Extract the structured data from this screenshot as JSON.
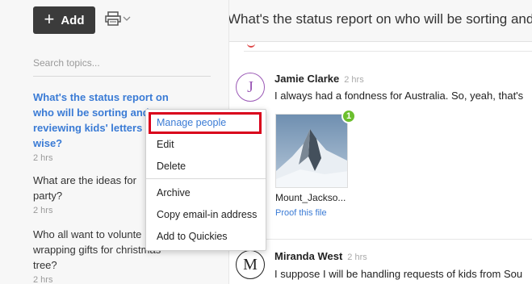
{
  "toolbar": {
    "add_label": "Add",
    "add_icon": "plus-icon",
    "print_icon": "printer-icon"
  },
  "sidebar": {
    "search_placeholder": "Search topics...",
    "topics": [
      {
        "lines": [
          "What's the status report on",
          "who will be sorting and",
          "reviewing kids' letters",
          "wise?"
        ],
        "time": "2 hrs",
        "active": true
      },
      {
        "lines": [
          "What are the ideas for",
          "party?"
        ],
        "time": "2 hrs",
        "active": false
      },
      {
        "lines": [
          "Who all want to volunte",
          "wrapping gifts for christmas",
          "tree?"
        ],
        "time": "2 hrs",
        "active": false
      }
    ]
  },
  "main": {
    "title": "What's the status report on who will be sorting and",
    "messages": [
      {
        "avatar": "J",
        "author": "Jamie Clarke",
        "time": "2 hrs",
        "text": "I always had a fondness for Australia. So, yeah, that's",
        "attachment": {
          "badge": "1",
          "filename": "Mount_Jackso...",
          "link": "Proof this file"
        }
      },
      {
        "avatar": "M",
        "author": "Miranda West",
        "time": "2 hrs",
        "text": "I suppose I will be handling requests of kids from Sou"
      }
    ]
  },
  "context_menu": {
    "items": [
      "Manage people",
      "Edit",
      "Delete",
      "Archive",
      "Copy email-in address",
      "Add to Quickies"
    ],
    "highlight_color": "#d9001b"
  }
}
